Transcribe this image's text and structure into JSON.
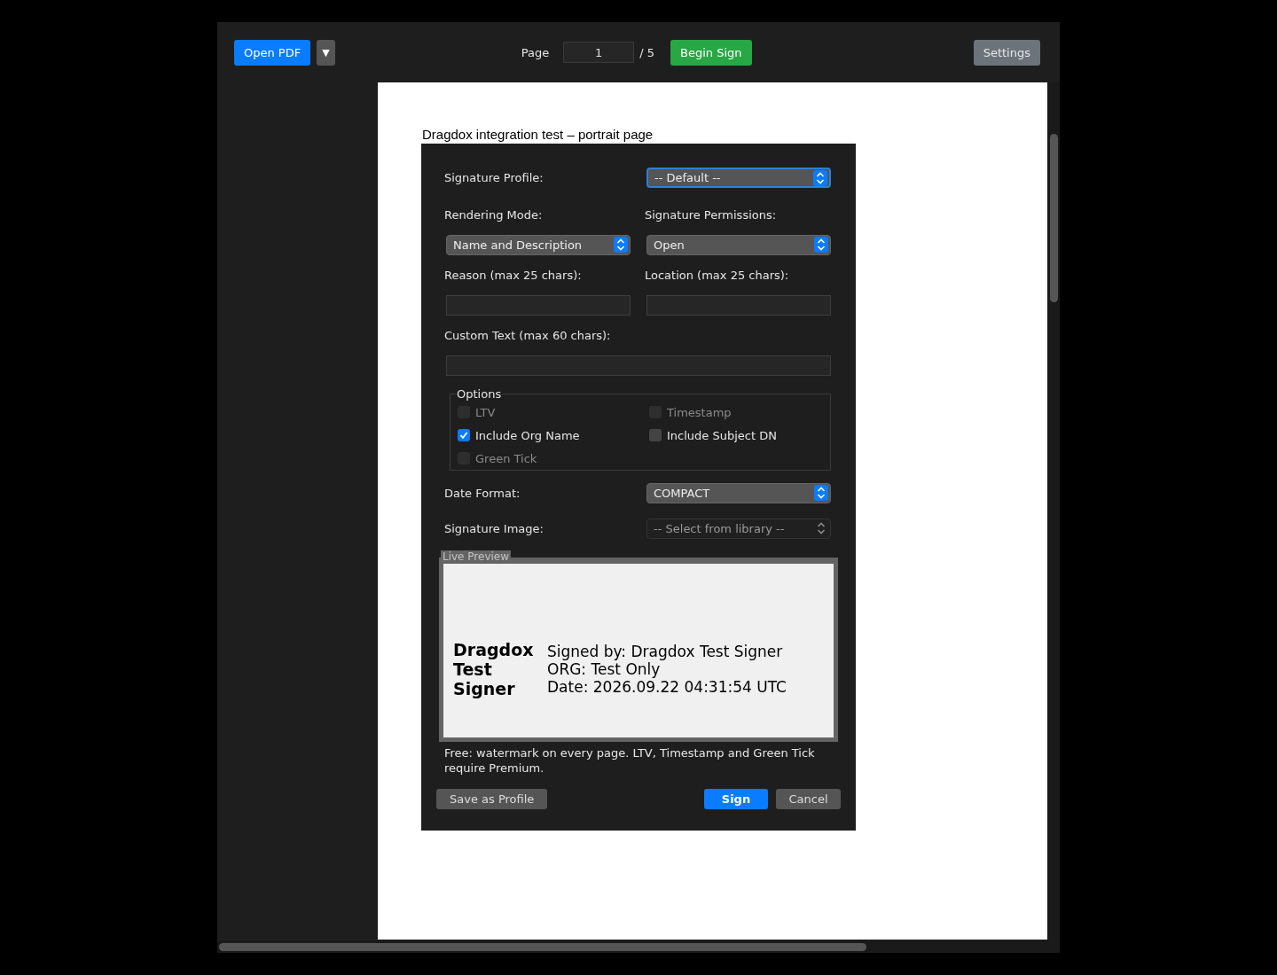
{
  "toolbar": {
    "open_button": "Open PDF",
    "menu_button": "▼",
    "page_label": "Page",
    "page_value": "1",
    "page_total": "/ 5",
    "begin_sign_button": "Begin Sign",
    "settings_button": "Settings"
  },
  "document": {
    "title": "Dragdox integration test – portrait page"
  },
  "dialog": {
    "profile": {
      "label": "Signature Profile:",
      "value": "-- Default --",
      "focused": true
    },
    "rendering_mode": {
      "label": "Rendering Mode:",
      "value": "Name and Description"
    },
    "permissions": {
      "label": "Signature Permissions:",
      "value": "Open"
    },
    "reason": {
      "label": "Reason (max 25 chars):"
    },
    "location": {
      "label": "Location (max 25 chars):"
    },
    "custom_text": {
      "label": "Custom Text (max 60 chars):"
    },
    "options": {
      "title": "Options",
      "items": [
        {
          "label": "LTV",
          "checked": false,
          "disabled": true
        },
        {
          "label": "Timestamp",
          "checked": false,
          "disabled": true
        },
        {
          "label": "Include Org Name",
          "checked": true,
          "disabled": false
        },
        {
          "label": "Include Subject DN",
          "checked": false,
          "disabled": false
        },
        {
          "label": "Green Tick",
          "checked": false,
          "disabled": true
        }
      ]
    },
    "date_format": {
      "label": "Date Format:",
      "value": "COMPACT",
      "disabled": false
    },
    "signature_image": {
      "label": "Signature Image:",
      "value": "-- Select from library --",
      "disabled": true
    },
    "preview": {
      "title": "Live Preview",
      "name": "Dragdox Test Signer",
      "lines": [
        "Signed by: Dragdox Test Signer",
        "ORG: Test Only",
        "Date: 2026.09.22 04:31:54 UTC"
      ]
    },
    "note": "Free: watermark on every page. LTV, Timestamp and Green Tick require Premium.",
    "buttons": {
      "save_profile": "Save as Profile",
      "sign": "Sign",
      "cancel": "Cancel"
    }
  }
}
